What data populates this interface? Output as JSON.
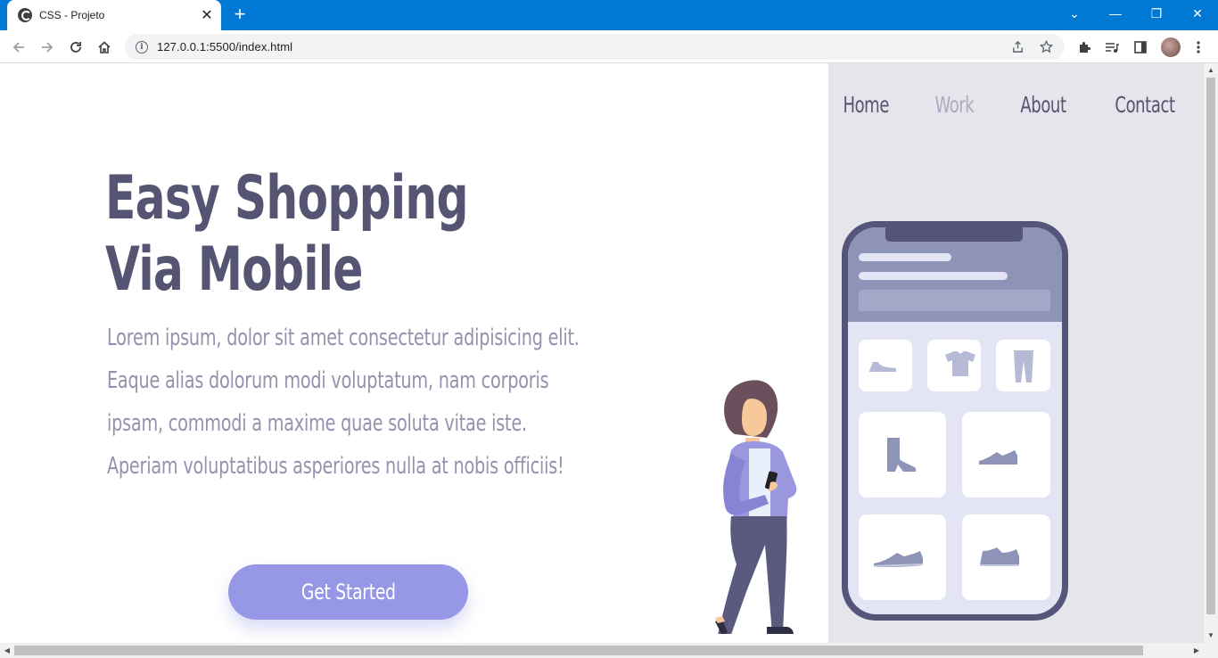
{
  "browser": {
    "tab_title": "CSS - Projeto",
    "tab_close": "✕",
    "new_tab": "+",
    "url": "127.0.0.1:5500/index.html",
    "window_controls": {
      "tabsearch": "⌄",
      "minimize": "—",
      "restore": "❐",
      "close": "✕"
    }
  },
  "site": {
    "nav": [
      {
        "label": "Home",
        "active": false
      },
      {
        "label": "Work",
        "active": true
      },
      {
        "label": "About",
        "active": false
      },
      {
        "label": "Contact",
        "active": false
      }
    ],
    "headline_line1": "Easy Shopping",
    "headline_line2": "Via Mobile",
    "body": "Lorem ipsum, dolor sit amet consectetur adipisicing elit. Eaque alias dolorum modi voluptatum, nam corporis ipsam, commodi a maxime quae soluta vitae iste. Aperiam voluptatibus asperiores nulla at nobis officiis!",
    "cta_label": "Get Started"
  },
  "colors": {
    "browser_accent": "#0078d4",
    "heading": "#555573",
    "body_text": "#9393ad",
    "nav_muted": "#a9a9c0",
    "cta_bg": "#9698e6",
    "panel_bg": "#e5e5eb",
    "phone_frame": "#55557a",
    "phone_header": "#8e94b8"
  },
  "icons": {
    "back": "arrow-left-icon",
    "forward": "arrow-right-icon",
    "reload": "reload-icon",
    "home": "home-icon",
    "info": "info-icon",
    "share": "share-icon",
    "bookmark": "star-icon",
    "extensions": "puzzle-icon",
    "media": "media-queue-icon",
    "sidepanel": "side-panel-icon",
    "menu": "kebab-menu-icon"
  }
}
